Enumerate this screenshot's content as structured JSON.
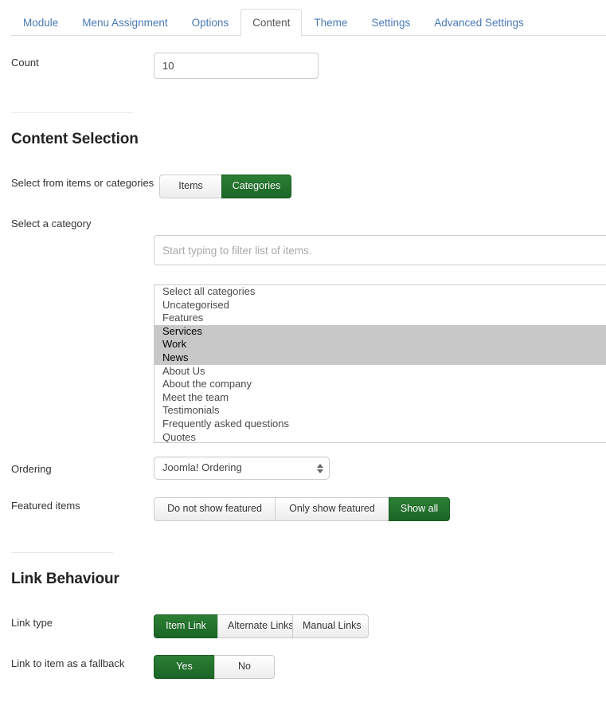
{
  "tabs": [
    {
      "label": "Module",
      "active": false
    },
    {
      "label": "Menu Assignment",
      "active": false
    },
    {
      "label": "Options",
      "active": false
    },
    {
      "label": "Content",
      "active": true
    },
    {
      "label": "Theme",
      "active": false
    },
    {
      "label": "Settings",
      "active": false
    },
    {
      "label": "Advanced Settings",
      "active": false
    }
  ],
  "count": {
    "label": "Count",
    "value": "10",
    "placeholder": ""
  },
  "content_selection": {
    "title": "Content Selection",
    "source": {
      "label": "Select from items or categories",
      "options": [
        {
          "label": "Items",
          "active": false
        },
        {
          "label": "Categories",
          "active": true
        }
      ]
    },
    "category": {
      "label": "Select a category",
      "filter_placeholder": "Start typing to filter list of items.",
      "filter_value": "",
      "options": [
        {
          "label": "Select all categories",
          "selected": false
        },
        {
          "label": "Uncategorised",
          "selected": false
        },
        {
          "label": "Features",
          "selected": false
        },
        {
          "label": "Services",
          "selected": true
        },
        {
          "label": "Work",
          "selected": true
        },
        {
          "label": "News",
          "selected": true
        },
        {
          "label": "About Us",
          "selected": false
        },
        {
          "label": "About the company",
          "selected": false
        },
        {
          "label": "Meet the team",
          "selected": false
        },
        {
          "label": "Testimonials",
          "selected": false
        },
        {
          "label": "Frequently asked questions",
          "selected": false
        },
        {
          "label": "Quotes",
          "selected": false
        }
      ]
    },
    "ordering": {
      "label": "Ordering",
      "value": "Joomla! Ordering"
    },
    "featured": {
      "label": "Featured items",
      "options": [
        {
          "label": "Do not show featured",
          "active": false
        },
        {
          "label": "Only show featured",
          "active": false
        },
        {
          "label": "Show all",
          "active": true
        }
      ]
    }
  },
  "link_behaviour": {
    "title": "Link Behaviour",
    "link_type": {
      "label": "Link type",
      "options": [
        {
          "label": "Item Link",
          "active": true
        },
        {
          "label": "Alternate Links",
          "active": false
        },
        {
          "label": "Manual Links",
          "active": false
        }
      ]
    },
    "fallback": {
      "label": "Link to item as a fallback",
      "options": [
        {
          "label": "Yes",
          "active": true
        },
        {
          "label": "No",
          "active": false
        }
      ]
    }
  },
  "colors": {
    "accent_green": "#1f6f2b",
    "tab_link": "#4a7ab5",
    "selection_gray": "#c8c8c8",
    "border": "#cccccc"
  }
}
